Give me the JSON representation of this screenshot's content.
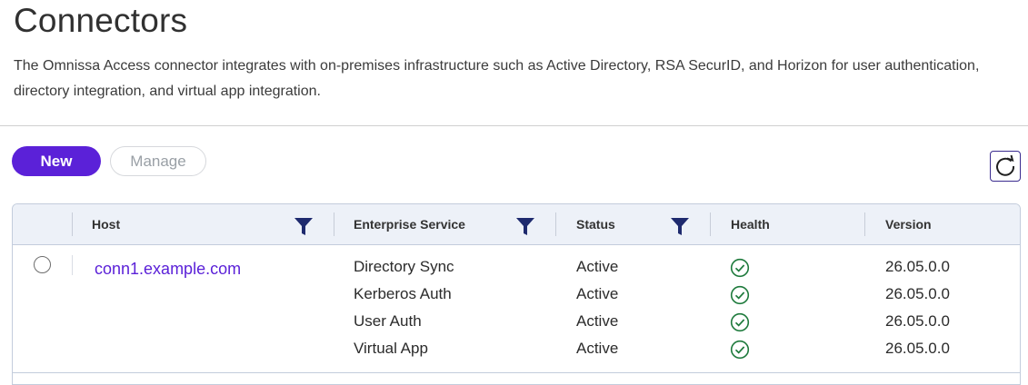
{
  "page": {
    "title": "Connectors",
    "description": "The Omnissa Access connector integrates with on-premises infrastructure such as Active Directory, RSA SecurID, and Horizon for user authentication, directory integration, and virtual app integration."
  },
  "toolbar": {
    "new_label": "New",
    "manage_label": "Manage"
  },
  "table": {
    "columns": {
      "host": "Host",
      "service": "Enterprise Service",
      "status": "Status",
      "health": "Health",
      "version": "Version"
    },
    "rows": [
      {
        "host": "conn1.example.com",
        "services": [
          {
            "name": "Directory Sync",
            "status": "Active",
            "health": "healthy",
            "version": "26.05.0.0"
          },
          {
            "name": "Kerberos Auth",
            "status": "Active",
            "health": "healthy",
            "version": "26.05.0.0"
          },
          {
            "name": "User Auth",
            "status": "Active",
            "health": "healthy",
            "version": "26.05.0.0"
          },
          {
            "name": "Virtual App",
            "status": "Active",
            "health": "healthy",
            "version": "26.05.0.0"
          }
        ]
      }
    ]
  },
  "colors": {
    "accent": "#5b21d8",
    "filter_icon": "#1e2a6e",
    "healthy": "#1e7a3c"
  },
  "icons": {
    "refresh": "refresh-icon",
    "filter": "filter-icon",
    "health": "check-circle-icon"
  }
}
